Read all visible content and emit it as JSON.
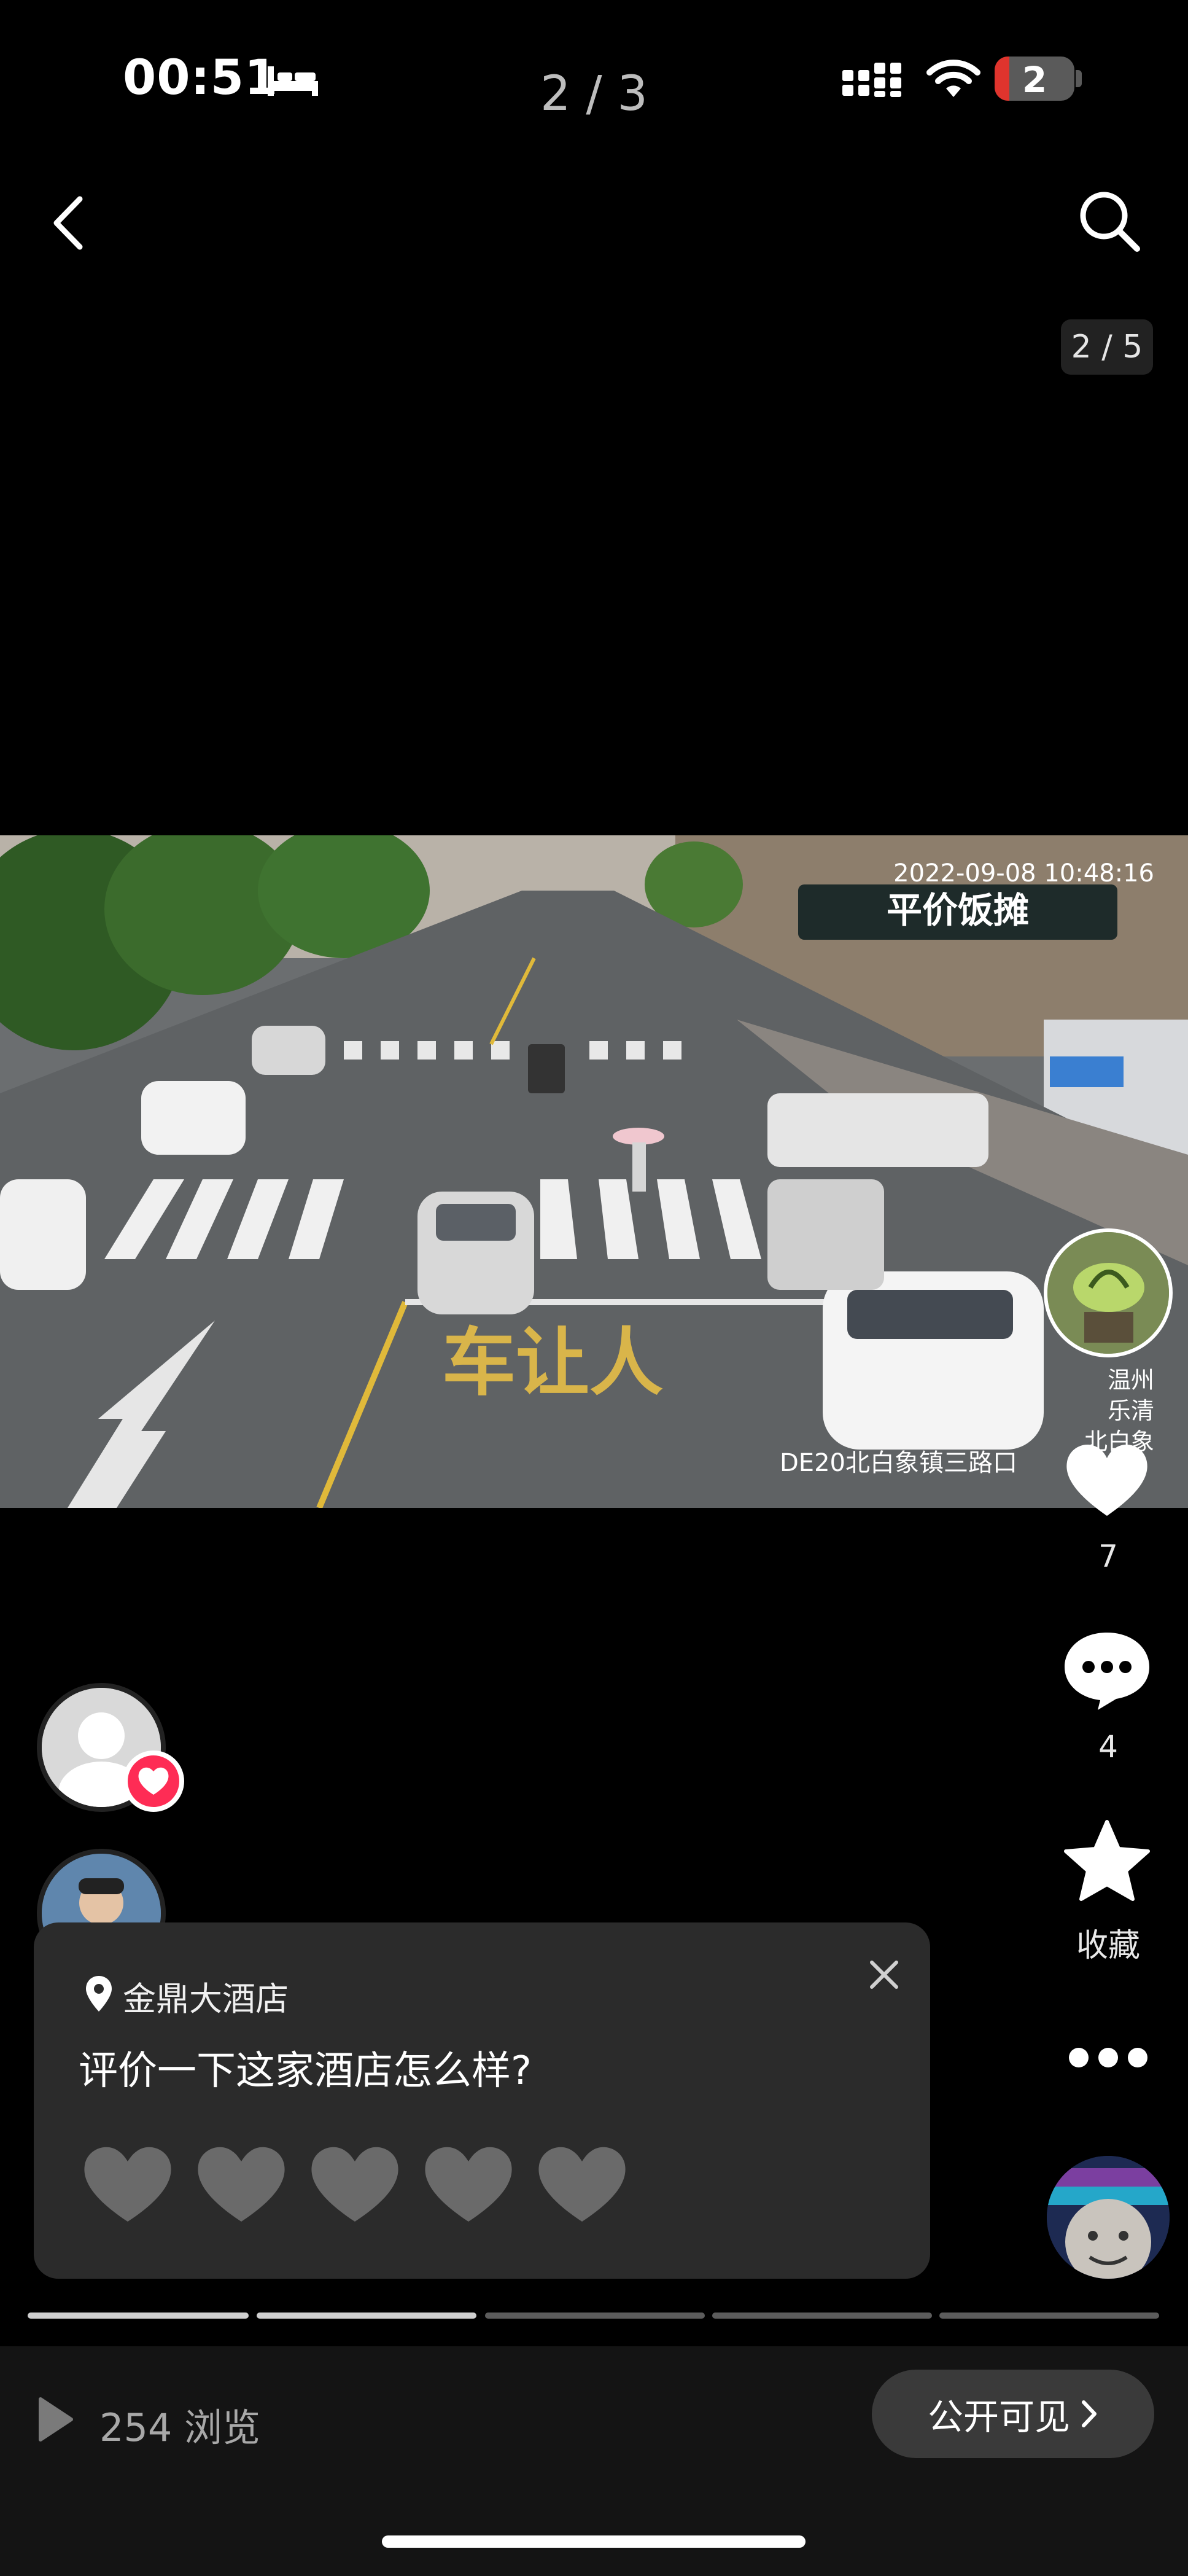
{
  "status_bar": {
    "time": "00:51",
    "page_counter": "2 / 3",
    "battery": "2",
    "icons": [
      "bed-icon",
      "signal-icon",
      "wifi-icon",
      "battery-icon"
    ]
  },
  "nav": {
    "back_icon": "chevron-left-icon",
    "search_icon": "search-icon",
    "image_counter": "2 / 5"
  },
  "photo": {
    "timestamp": "2022-09-08 10:48:16",
    "shop_sign": "平价饭摊",
    "road_marking": "车让人",
    "camera_label": "DE20北白象镇三路口",
    "side_text": [
      "温州",
      "乐清",
      "北白象"
    ]
  },
  "right_rail": {
    "like_count": "7",
    "comment_count": "4",
    "favorite_label": "收藏",
    "more_icon": "more-dots-icon"
  },
  "rating_card": {
    "location": "金鼎大酒店",
    "question": "评价一下这家酒店怎么样?",
    "hearts_total": 5
  },
  "progress": {
    "segments": 5,
    "active_segments": 2
  },
  "bottom_bar": {
    "views": "254 浏览",
    "visibility_label": "公开可见"
  },
  "colors": {
    "accent_pink": "#fe2c55",
    "card_bg": "#2b2b2b",
    "heart_inactive": "#6a6a6a"
  }
}
